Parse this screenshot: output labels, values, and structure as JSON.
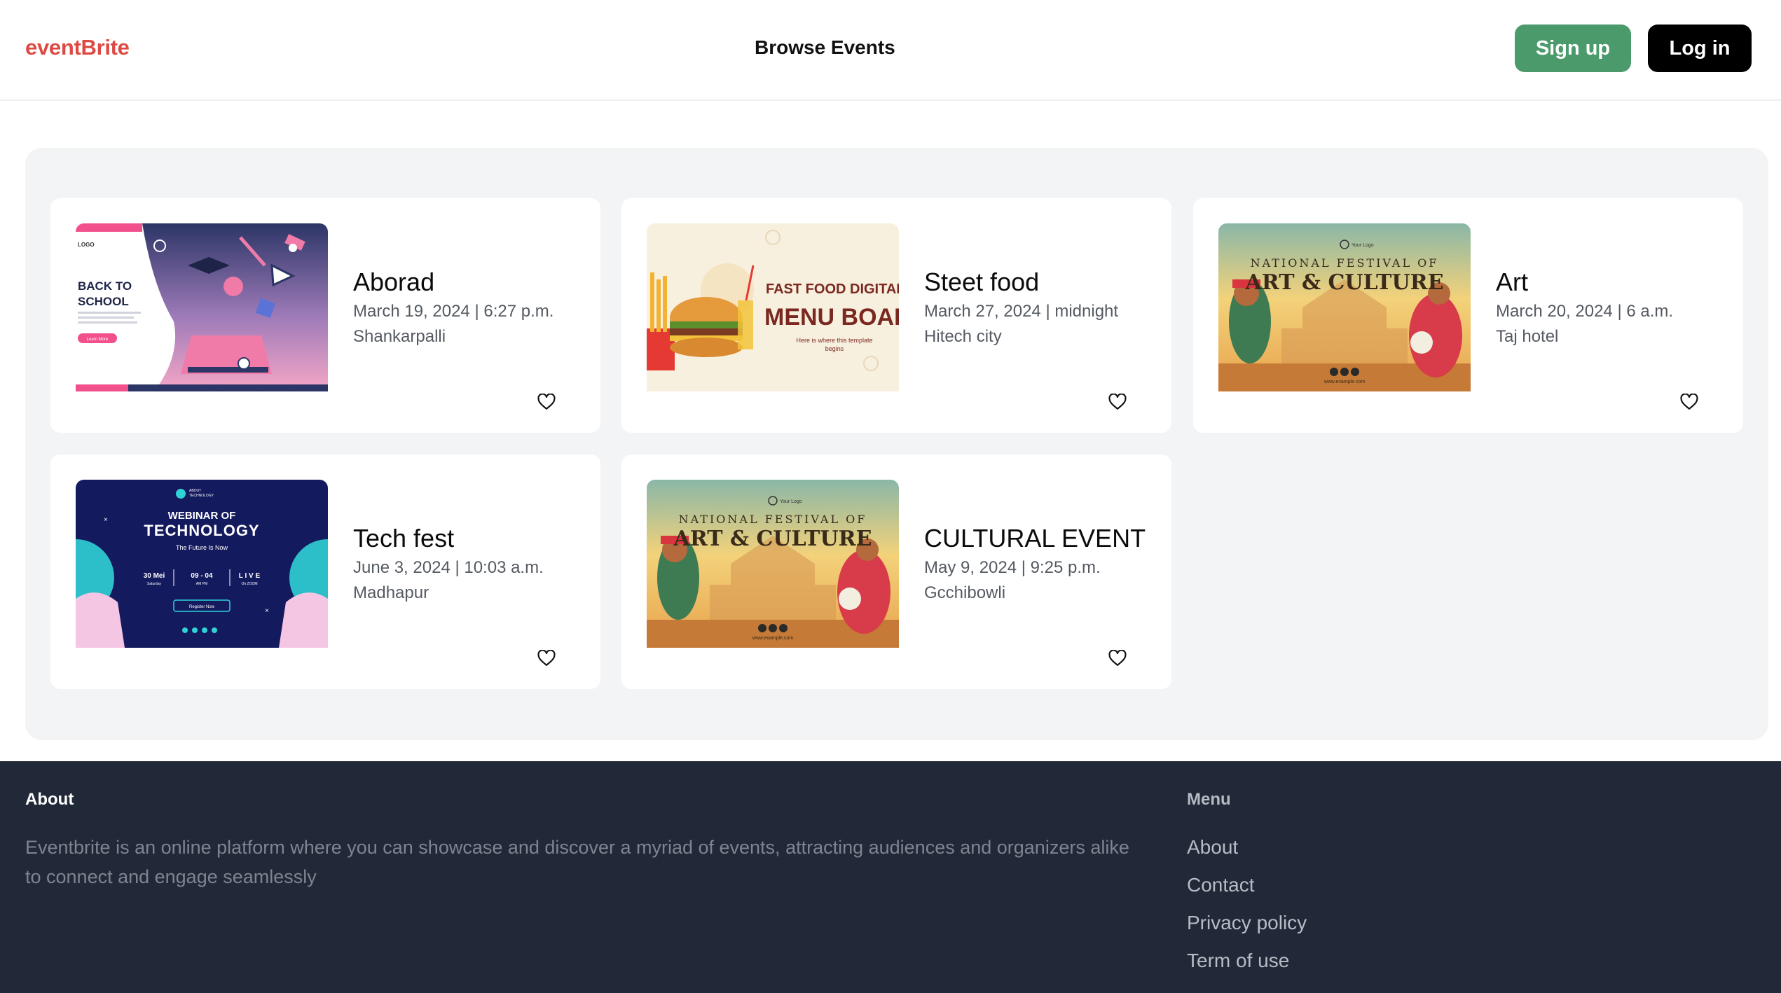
{
  "header": {
    "logo": "eventBrite",
    "nav_browse": "Browse Events",
    "signup_label": "Sign up",
    "login_label": "Log in"
  },
  "events": [
    {
      "title": "Aborad",
      "date": "March 19, 2024 | 6:27 p.m.",
      "venue": "Shankarpalli",
      "image": {
        "heading": "BACK TO SCHOOL",
        "tag": "LOGO",
        "cta": "Learn More"
      }
    },
    {
      "title": "Steet food",
      "date": "March 27, 2024 | midnight",
      "venue": "Hitech city",
      "image": {
        "line1": "FAST FOOD DIGITAL",
        "line2": "MENU BOARD",
        "line3": "Here is where this template begins"
      }
    },
    {
      "title": "Art",
      "date": "March 20, 2024 | 6 a.m.",
      "venue": "Taj hotel",
      "image": {
        "line1": "NATIONAL FESTIVAL OF",
        "line2": "ART & CULTURE",
        "logo": "Your Logo",
        "url": "www.example.com"
      }
    },
    {
      "title": "Tech fest",
      "date": "June 3, 2024 | 10:03 a.m.",
      "venue": "Madhapur",
      "image": {
        "brand": "ABOUT TECHNOLOGY",
        "line1": "WEBINAR OF",
        "line2": "TECHNOLOGY",
        "line3": "The Future Is Now",
        "day": "30 Mei",
        "weekday": "Saturday",
        "time": "09 - 04",
        "ampm": "AM    PM",
        "live": "L I V E",
        "zoom": "On ZOOM",
        "cta": "Register Now"
      }
    },
    {
      "title": "CULTURAL EVENT",
      "date": "May 9, 2024 | 9:25 p.m.",
      "venue": "Gcchibowli",
      "image": {
        "line1": "NATIONAL FESTIVAL OF",
        "line2": "ART & CULTURE",
        "logo": "Your Logo",
        "url": "www.example.com"
      }
    }
  ],
  "footer": {
    "about_title": "About",
    "about_text": "Eventbrite is an online platform where you can showcase and discover a myriad of events, attracting audiences and organizers alike to connect and engage seamlessly",
    "menu_title": "Menu",
    "menu_items": [
      "About",
      "Contact",
      "Privacy policy",
      "Term of use"
    ]
  },
  "colors": {
    "brand": "#dc4a43",
    "signup": "#4a9a6b",
    "login": "#000000",
    "panel": "#f3f4f6",
    "footer": "#212837"
  },
  "icons": [
    "heart-icon"
  ]
}
